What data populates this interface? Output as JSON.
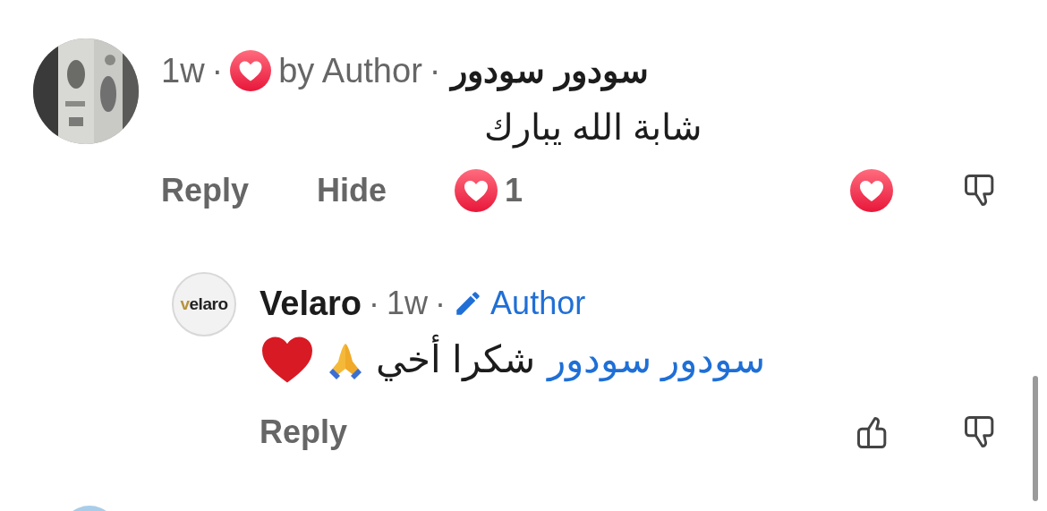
{
  "comments": [
    {
      "time": "1w",
      "separator": "·",
      "author_liked": true,
      "author_label": "by Author",
      "name": "سودور سودور",
      "text": "شابة الله يبارك",
      "reply_label": "Reply",
      "hide_label": "Hide",
      "reaction_count": "1",
      "liked": true,
      "replies": [
        {
          "logo": {
            "accent": "v",
            "rest": "elaro"
          },
          "name": "Velaro",
          "time": "1w",
          "separator": "·",
          "is_author": true,
          "author_label": "Author",
          "mention": "سودور سودور",
          "text": "شكرا أخي",
          "reply_label": "Reply",
          "liked": false
        }
      ]
    }
  ]
}
